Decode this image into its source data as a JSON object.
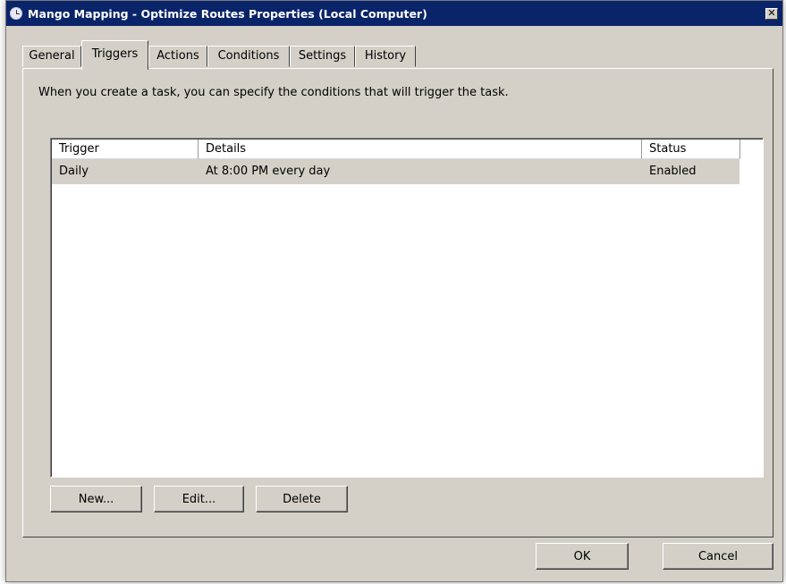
{
  "window": {
    "title": "Mango Mapping - Optimize Routes Properties (Local Computer)",
    "close_label": "✕"
  },
  "tabs": [
    {
      "label": "General",
      "active": false
    },
    {
      "label": "Triggers",
      "active": true
    },
    {
      "label": "Actions",
      "active": false
    },
    {
      "label": "Conditions",
      "active": false
    },
    {
      "label": "Settings",
      "active": false
    },
    {
      "label": "History",
      "active": false
    }
  ],
  "triggers_tab": {
    "description": "When you create a task, you can specify the conditions that will trigger the task.",
    "columns": [
      "Trigger",
      "Details",
      "Status"
    ],
    "rows": [
      {
        "trigger": "Daily",
        "details": "At 8:00 PM every day",
        "status": "Enabled",
        "selected": true
      }
    ],
    "buttons": {
      "new": "New...",
      "edit": "Edit...",
      "delete": "Delete"
    }
  },
  "footer": {
    "ok": "OK",
    "cancel": "Cancel"
  }
}
